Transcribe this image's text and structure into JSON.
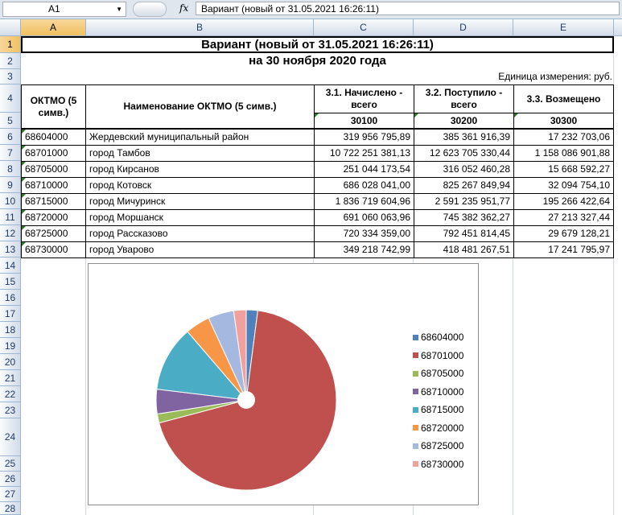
{
  "formula_bar": {
    "name_box": "A1",
    "fx": "fx",
    "formula": "Вариант (новый от 31.05.2021 16:26:11)"
  },
  "columns": [
    "A",
    "B",
    "C",
    "D",
    "E"
  ],
  "rows": [
    "1",
    "2",
    "3",
    "4",
    "5",
    "6",
    "7",
    "8",
    "9",
    "10",
    "11",
    "12",
    "13",
    "14",
    "15",
    "16",
    "17",
    "18",
    "19",
    "20",
    "21",
    "22",
    "23",
    "24",
    "25",
    "26",
    "27",
    "28"
  ],
  "sheet": {
    "title": "Вариант (новый от 31.05.2021 16:26:11)",
    "subtitle": "на 30 ноября 2020 года",
    "unit": "Единица измерения:  руб.",
    "headers": {
      "oktmo": "ОКТМО (5 симв.)",
      "name": "Наименование ОКТМО (5 симв.)",
      "c": "3.1. Начислено - всего",
      "d": "3.2. Поступило - всего",
      "e": "3.3. Возмещено",
      "code_c": "30100",
      "code_d": "30200",
      "code_e": "30300"
    },
    "table_rows": [
      {
        "oktmo": "68604000",
        "name": "Жердевский муниципальный район",
        "c": "319 956 795,89",
        "d": "385 361 916,39",
        "e": "17 232 703,06"
      },
      {
        "oktmo": "68701000",
        "name": "город Тамбов",
        "c": "10 722 251 381,13",
        "d": "12 623 705 330,44",
        "e": "1 158 086 901,88"
      },
      {
        "oktmo": "68705000",
        "name": "город Кирсанов",
        "c": "251 044 173,54",
        "d": "316 052 460,28",
        "e": "15 668 592,27"
      },
      {
        "oktmo": "68710000",
        "name": "город Котовск",
        "c": "686 028 041,00",
        "d": "825 267 849,94",
        "e": "32 094 754,10"
      },
      {
        "oktmo": "68715000",
        "name": "город Мичуринск",
        "c": "1 836 719 604,96",
        "d": "2 591 235 951,77",
        "e": "195 266 422,64"
      },
      {
        "oktmo": "68720000",
        "name": "город Моршанск",
        "c": "691 060 063,96",
        "d": "745 382 362,27",
        "e": "27 213 327,44"
      },
      {
        "oktmo": "68725000",
        "name": "город Рассказово",
        "c": "720 334 359,00",
        "d": "792 451 814,45",
        "e": "29 679 128,21"
      },
      {
        "oktmo": "68730000",
        "name": "город Уварово",
        "c": "349 218 742,99",
        "d": "418 481 267,51",
        "e": "17 241 795,97"
      }
    ]
  },
  "chart_data": {
    "type": "pie",
    "categories": [
      "68604000",
      "68701000",
      "68705000",
      "68710000",
      "68715000",
      "68720000",
      "68725000",
      "68730000"
    ],
    "values": [
      319956795.89,
      10722251381.13,
      251044173.54,
      686028041.0,
      1836719604.96,
      691060063.96,
      720334359.0,
      349218742.99
    ],
    "colors": [
      "#4f81bd",
      "#c0504d",
      "#9bbb59",
      "#8064a2",
      "#4bacc6",
      "#f79646",
      "#a5b9e0",
      "#f2a09e"
    ],
    "hole": true,
    "legend": "right"
  }
}
